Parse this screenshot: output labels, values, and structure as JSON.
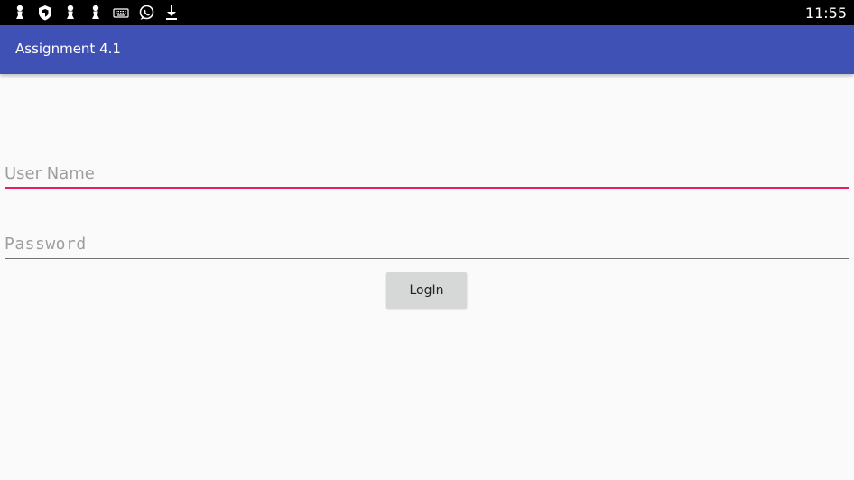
{
  "status_bar": {
    "time": "11:55",
    "icons": [
      "chess-pawn-icon",
      "shield-icon",
      "chess-pawn-icon",
      "chess-pawn-icon",
      "keyboard-icon",
      "whatsapp-icon",
      "download-icon"
    ]
  },
  "app_bar": {
    "title": "Assignment 4.1",
    "color": "#3f51b5"
  },
  "form": {
    "username": {
      "value": "",
      "placeholder": "User Name",
      "underline_color": "#e91e63"
    },
    "password": {
      "value": "",
      "placeholder": "Password",
      "underline_color": "#757575"
    },
    "login_label": "LogIn"
  }
}
